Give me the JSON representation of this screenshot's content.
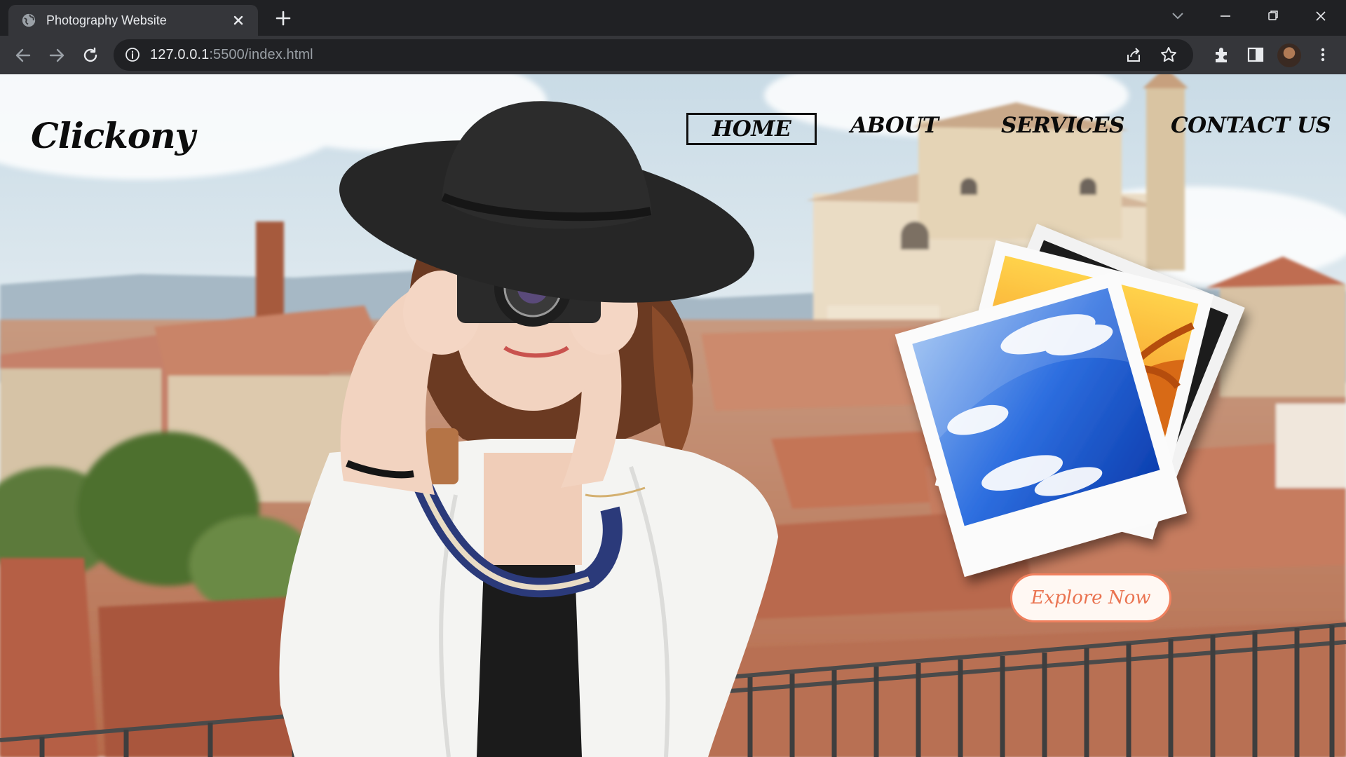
{
  "browser": {
    "tab_title": "Photography Website",
    "url_host": "127.0.0.1",
    "url_rest": ":5500/index.html"
  },
  "site": {
    "logo": "Clickony",
    "nav": [
      "HOME",
      "ABOUT",
      "SERVICES",
      "CONTACT US"
    ],
    "active_nav": "HOME",
    "cta": "Explore Now"
  },
  "colors": {
    "accent": "#f0805e",
    "chrome_bg": "#202124",
    "toolbar_bg": "#35363a"
  }
}
